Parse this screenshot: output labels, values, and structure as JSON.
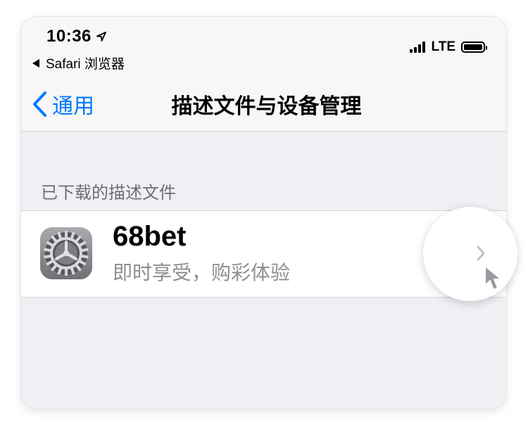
{
  "status_bar": {
    "time": "10:36",
    "back_app_label": "Safari 浏览器",
    "network": "LTE"
  },
  "nav": {
    "back_label": "通用",
    "title": "描述文件与设备管理"
  },
  "section": {
    "header": "已下载的描述文件"
  },
  "profile": {
    "name": "68bet",
    "subtitle": "即时享受，购彩体验",
    "icon": "settings-gear-icon"
  },
  "colors": {
    "accent": "#007aff",
    "background": "#efeff4",
    "secondary_text": "#8e8e93"
  }
}
